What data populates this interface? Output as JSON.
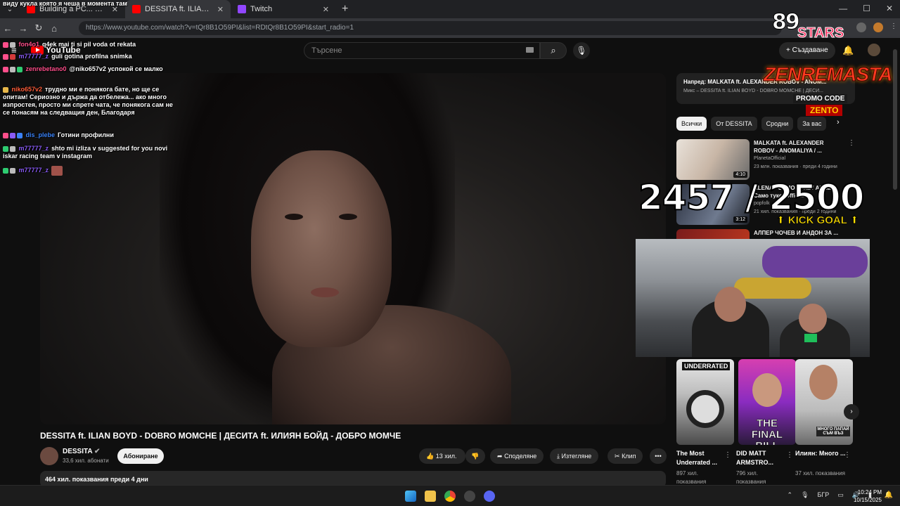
{
  "browser": {
    "tabs": [
      {
        "title": "Building a PC... Using Only the",
        "favicon_color": "#ff0000"
      },
      {
        "title": "DESSITA ft. ILIAN BOYD - DOBR",
        "favicon_color": "#ff0000",
        "active": true
      },
      {
        "title": "Twitch",
        "favicon_color": "#9146ff"
      }
    ],
    "new_tab": "+",
    "url": "https://www.youtube.com/watch?v=tQr8B1O59PI&list=RDtQr8B1O59PI&start_radio=1"
  },
  "youtube": {
    "logo_text": "YouTube",
    "search_placeholder": "Търсене",
    "create_label": "Създаване",
    "video": {
      "title": "DESSITA ft. ILIAN BOYD - DOBRO MOMCHE | ДЕСИТА ft. ИЛИЯН БОЙД - ДОБРО МОМЧЕ",
      "channel": "DESSITA",
      "subscribers": "33,6 хил. абонати",
      "subscribe_label": "Абониране",
      "likes": "13 хил.",
      "share_label": "Споделяне",
      "download_label": "Изтегляне",
      "clip_label": "Клип",
      "more_label": "•••",
      "views_line": "464 хил. показвания  преди 4 дни"
    },
    "mix": {
      "next_label": "Напред: MALKATA ft. ALEXANDER ROBOV - ANOM...",
      "sub_label": "Микс – DESSITA ft. ILIAN BOYD - DOBRO MOMCHE | ДЕСИ..."
    },
    "chips": [
      "Всички",
      "От DESSITA",
      "Сродни",
      "За вас"
    ],
    "recommendations": [
      {
        "title": "MALKATA ft. ALEXANDER ROBOV - ANOMALIYA / ...",
        "channel": "PlanetaOfficial",
        "meta": "23 млн. показвания · преди 4 години",
        "duration": "4:10"
      },
      {
        "title": "ALENA - САМО ТУКЕ / Alena - Само туке (Official ...",
        "channel": "popfolk",
        "meta": "21 хил. показвания · преди 2 години",
        "duration": "3:12"
      },
      {
        "title": "АЛПЕР ЧОЧЕВ И АНДОН ЗА ...",
        "channel": "",
        "meta": "",
        "duration": ""
      }
    ],
    "shorts": [
      {
        "title": "The Most Underrated ...",
        "views": "897 хил. показвания",
        "badge": "UNDERRATED"
      },
      {
        "title": "DID MATT ARMSTRO...",
        "views": "796 хил. показвания",
        "badge": "THE FINAL BILL"
      },
      {
        "title": "Илиян: Много ...",
        "views": "37 хил. показвания",
        "badge": "МНОГО ПАПАЙ СЪМ ВЪЗ"
      }
    ]
  },
  "stream_overlay": {
    "top_text": "виду кукла която я чеша в момента там",
    "chat": [
      {
        "user": "fon4o1",
        "text": "q4ek mai ti si pil voda ot rekata",
        "color": "#ff4f8b"
      },
      {
        "user": "m77777_z",
        "text": "guli gotina profilna snimka",
        "color": "#8a5cf6"
      },
      {
        "user": "zenrebetano0",
        "text": "@niko657v2 успокой се малко",
        "color": "#ff4f8b"
      },
      {
        "user": "niko657v2",
        "text": "трудно ми е понякога бате, но ще се опитам! Сериозно и държа да отбележа... ако много изпростея, просто ми спрете чата, че понякога сам не се понасям на следващия ден, Благодаря",
        "color": "#ff5e3a"
      },
      {
        "user": "dis_plebe",
        "text": "Готини профилни",
        "color": "#3b82f6"
      },
      {
        "user": "m77777_z",
        "text": "shto mi izliza v suggested for you novi iskar racing team v instagram",
        "color": "#8a5cf6"
      },
      {
        "user": "m77777_z",
        "text": "",
        "color": "#8a5cf6"
      }
    ],
    "stars_number": "89",
    "stars_word": "STARS",
    "sponsor": "ZENREMASTA",
    "promo_label": "PROMO CODE",
    "promo_code": "ZENTO",
    "goal_count": "2457 / 2500",
    "goal_label": "KICK GOAL"
  },
  "taskbar": {
    "lang": "БГР",
    "time": "10:24 PM",
    "date": "10/15/2025"
  }
}
